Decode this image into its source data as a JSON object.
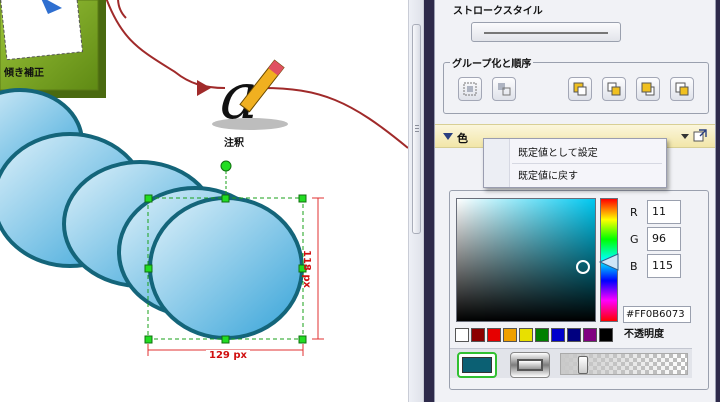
{
  "canvas": {
    "labels": {
      "shape_top": "傾き補正",
      "annotation": "注釈"
    },
    "dimensions": {
      "height": "118 px",
      "width": "129 px"
    }
  },
  "panel": {
    "stroke_style_title": "ストロークスタイル",
    "group_order_title": "グループ化と順序",
    "color_section": {
      "title": "色",
      "rgb": {
        "r_label": "R",
        "r": "11",
        "g_label": "G",
        "g": "96",
        "b_label": "B",
        "b": "115"
      },
      "hex": "#FF0B6073",
      "opacity_label": "不透明度",
      "opacity": 0.15,
      "fill_color": "#0B6073",
      "swatches": [
        "#ffffff",
        "#8b0000",
        "#e60000",
        "#f0a000",
        "#e8e000",
        "#008000",
        "#0000cc",
        "#000080",
        "#800080",
        "#000000"
      ]
    },
    "context_menu": {
      "items": [
        "既定値として設定",
        "既定値に戻す"
      ]
    }
  },
  "icons": {
    "group": "group-icon",
    "ungroup": "ungroup-icon",
    "bring_front": "bring-to-front-icon",
    "bring_forward": "bring-forward-icon",
    "send_backward": "send-backward-icon",
    "send_back": "send-to-back-icon",
    "popout": "popout-icon",
    "pencil": "pencil-icon"
  },
  "colors": {
    "ellipse_fill_light": "#cfe9f7",
    "ellipse_fill_dark": "#3aa6d9",
    "ellipse_stroke": "#14657a",
    "connector": "#a02a2a",
    "selection": "#1aa01a",
    "dimension": "#d01010",
    "panel_bg": "#2e2a4a",
    "shape_green": "#6e9a1e"
  }
}
